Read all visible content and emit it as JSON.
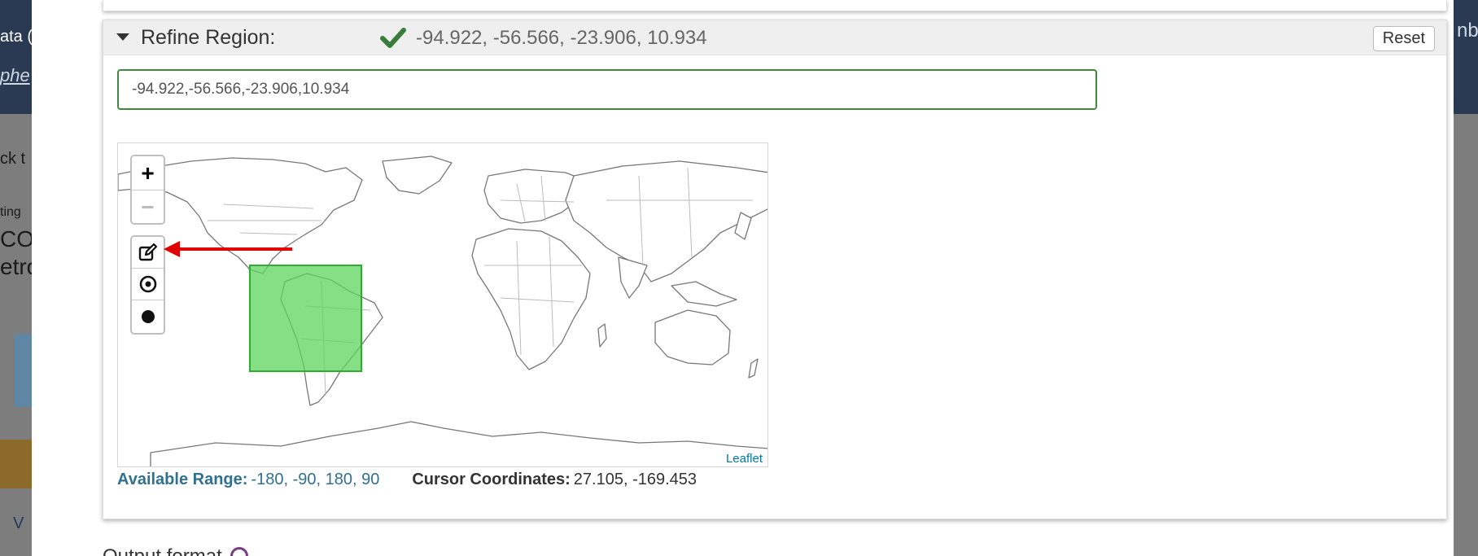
{
  "background": {
    "frag1": "ata (",
    "frag2": "phe",
    "frag3": "ck t",
    "frag4": "ting",
    "frag5": "CO-",
    "frag6": "etro",
    "frag7": "V",
    "frag8": "nbo"
  },
  "refine": {
    "title": "Refine Region:",
    "summary": "-94.922, -56.566, -23.906, 10.934",
    "reset_label": "Reset",
    "input_value": "-94.922,-56.566,-23.906,10.934"
  },
  "map": {
    "zoom_in": "+",
    "zoom_out": "−",
    "attribution": "Leaflet",
    "draw_tools": [
      "edit-rectangle-icon",
      "target-point-icon",
      "filled-circle-icon"
    ],
    "selection_bbox": [
      -94.922,
      -56.566,
      -23.906,
      10.934
    ],
    "selection_color": "#5cd65c"
  },
  "range": {
    "available_label": "Available Range:",
    "available_value": "-180, -90, 180, 90",
    "cursor_label": "Cursor Coordinates:",
    "cursor_value": "27.105, -169.453"
  },
  "output": {
    "label": "Output format"
  },
  "colors": {
    "accent_green": "#3f8a3a",
    "link_blue": "#31708f",
    "annotation_red": "#e00000"
  }
}
